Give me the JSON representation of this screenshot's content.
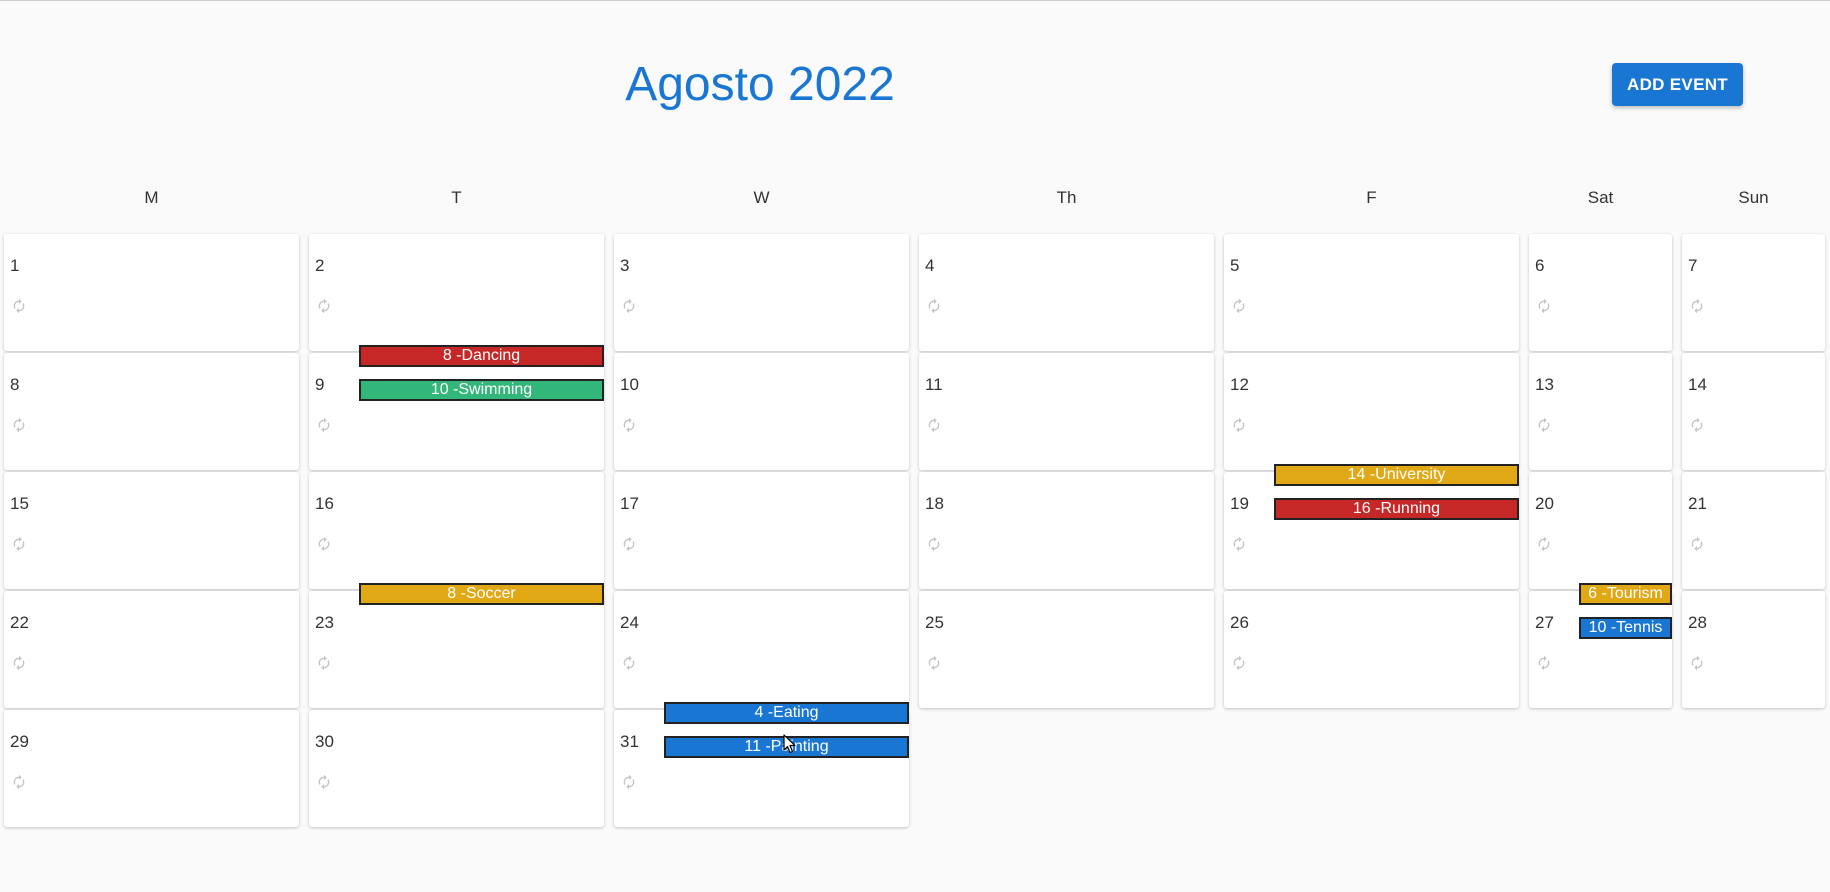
{
  "header": {
    "title": "Agosto 2022",
    "add_event_label": "ADD EVENT"
  },
  "weekdays": [
    "M",
    "T",
    "W",
    "Th",
    "F",
    "Sat",
    "Sun"
  ],
  "weeks": [
    [
      "1",
      "2",
      "3",
      "4",
      "5",
      "6",
      "7"
    ],
    [
      "8",
      "9",
      "10",
      "11",
      "12",
      "13",
      "14"
    ],
    [
      "15",
      "16",
      "17",
      "18",
      "19",
      "20",
      "21"
    ],
    [
      "22",
      "23",
      "24",
      "25",
      "26",
      "27",
      "28"
    ],
    [
      "29",
      "30",
      "31"
    ]
  ],
  "events": [
    {
      "label": "8 -Dancing",
      "color": "#c62828",
      "day": 9
    },
    {
      "label": "10 -Swimming",
      "color": "#33b679",
      "day": 9
    },
    {
      "label": "14 -University",
      "color": "#e0a814",
      "day": 19
    },
    {
      "label": "16 -Running",
      "color": "#c62828",
      "day": 19
    },
    {
      "label": "8 -Soccer",
      "color": "#e0a814",
      "day": 23
    },
    {
      "label": "6 -Tourism",
      "color": "#e0a814",
      "day": 27
    },
    {
      "label": "10 -Tennis",
      "color": "#1976d2",
      "day": 27
    },
    {
      "label": "4 -Eating",
      "color": "#1976d2",
      "day": 31
    },
    {
      "label": "11 -Painting",
      "color": "#1976d2",
      "day": 31
    }
  ],
  "icons": {
    "day_cell": "repeat-icon",
    "pointer": "cursor-icon"
  },
  "colors": {
    "accent": "#1976d2"
  }
}
